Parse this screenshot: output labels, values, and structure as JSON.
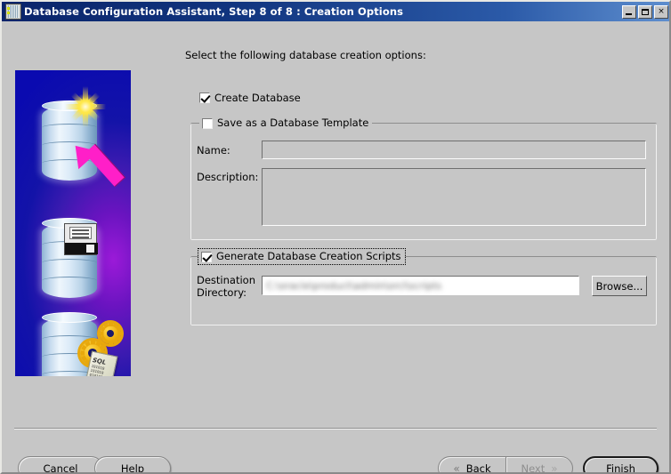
{
  "window": {
    "title": "Database Configuration Assistant, Step 8 of 8 : Creation Options",
    "icon": "database-icon",
    "controls": {
      "minimize": "minimize-icon",
      "maximize": "maximize-icon",
      "close": "×"
    }
  },
  "banner": {
    "alt": "oracle-database-creation-graphic",
    "scroll_label": "SQL",
    "scroll_lines": "101010\n101010\n010101\n101010\n010101",
    "colors": {
      "blue": "#0a0ad2",
      "purple": "#9b1ad8",
      "arrow": "#ff1fc8",
      "star": "#ffd400",
      "gear": "#f0b310"
    }
  },
  "main": {
    "intro": "Select the following database creation options:",
    "create_database": {
      "label": "Create Database",
      "checked": true
    },
    "template_group": {
      "title": "Save as a Database Template",
      "checked": false,
      "enabled": false,
      "name_label": "Name:",
      "name_value": "",
      "description_label": "Description:",
      "description_value": ""
    },
    "scripts_group": {
      "title": "Generate Database Creation Scripts",
      "checked": true,
      "focused": true,
      "destination_label": "Destination\nDirectory:",
      "destination_value": "C:\\oracle\\product\\admin\\orcl\\scripts",
      "destination_redacted": true,
      "browse_label": "Browse..."
    }
  },
  "footer": {
    "cancel": {
      "label": "Cancel",
      "mnemonic": ""
    },
    "help": {
      "label": "Help",
      "mnemonic": ""
    },
    "back": {
      "label_before": "",
      "mnemonic": "B",
      "label_after": "ack",
      "enabled": true,
      "chevron": "«"
    },
    "next": {
      "label_before": "",
      "mnemonic": "N",
      "label_after": "ext",
      "enabled": false,
      "chevron": "»"
    },
    "finish": {
      "label_before": "",
      "mnemonic": "F",
      "label_after": "inish",
      "enabled": true,
      "primary": true
    }
  }
}
